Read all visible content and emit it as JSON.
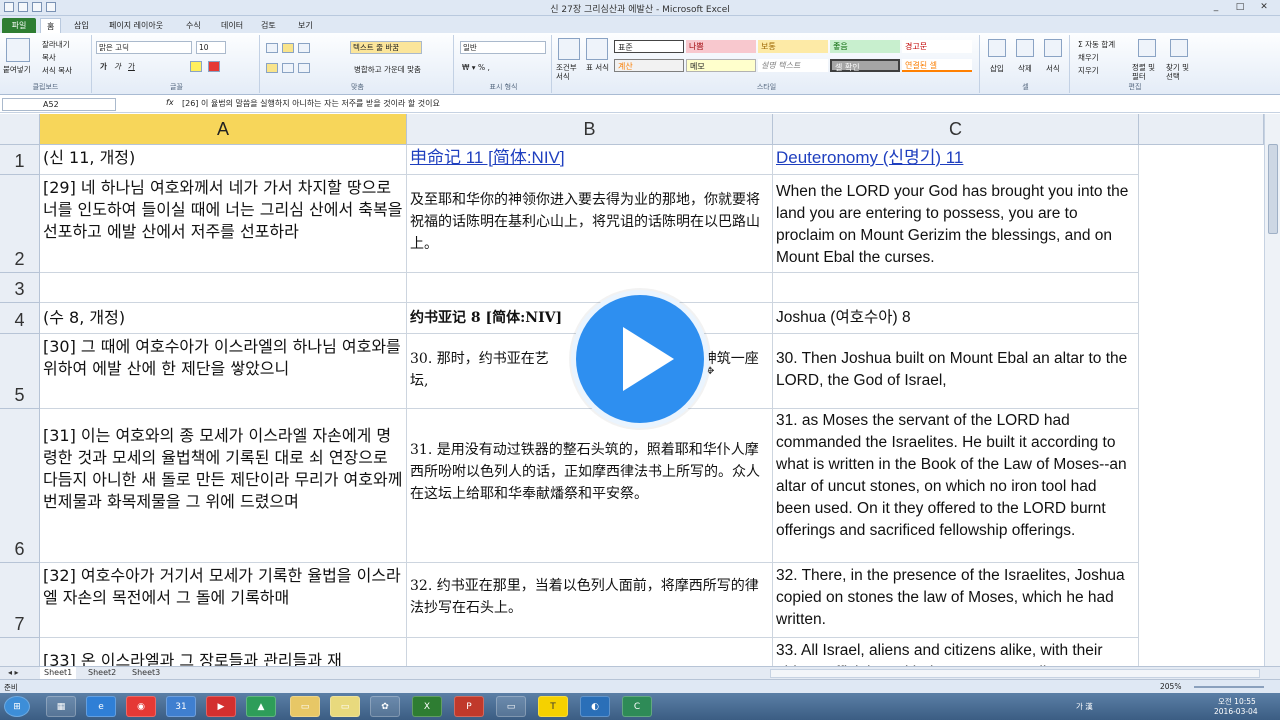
{
  "window": {
    "title": "신 27장 그리심산과 에발산 - Microsoft Excel",
    "controls": [
      "_",
      "□",
      "✕"
    ]
  },
  "ribbon_tabs": [
    "파일",
    "홈",
    "삽입",
    "페이지 레이아웃",
    "수식",
    "데이터",
    "검토",
    "보기"
  ],
  "ribbon": {
    "clipboard": {
      "paste": "붙여넣기",
      "cut": "잘라내기",
      "copy": "복사",
      "format_painter": "서식 복사",
      "label": "클립보드"
    },
    "font": {
      "name": "맑은 고딕",
      "size": "10",
      "label": "글꼴"
    },
    "alignment": {
      "wrap": "텍스트 줄 바꿈",
      "merge": "병합하고 가운데 맞춤",
      "label": "맞춤"
    },
    "number": {
      "format": "일반",
      "label": "표시 형식"
    },
    "styles": {
      "cond_format": "조건부 서식",
      "table_format": "표 서식",
      "cells": [
        "표준",
        "나쁨",
        "보통",
        "좋음",
        "경고문",
        "계산",
        "메모",
        "설명 텍스트",
        "셀 확인",
        "연결된 셀"
      ],
      "label": "스타일"
    },
    "cells_group": {
      "insert": "삽입",
      "delete": "삭제",
      "format": "서식",
      "label": "셀"
    },
    "editing": {
      "autosum": "자동 합계",
      "fill": "채우기",
      "clear": "지우기",
      "sort": "정렬 및 필터",
      "find": "찾기 및 선택",
      "label": "편집"
    }
  },
  "formula_bar": {
    "name_box": "A52",
    "fx": "fx",
    "formula": "[26] 이 율법의 말씀을 실행하지 아니하는 자는 저주를 받을 것이라 할 것이요"
  },
  "columns": [
    "A",
    "B",
    "C"
  ],
  "rows": [
    {
      "num": "1",
      "a": "(신 11, 개정)",
      "b": "申命记 11 [简体:NIV]",
      "c": "Deuteronomy (신명기) 11"
    },
    {
      "num": "2",
      "a": "[29] 네 하나님 여호와께서 네가 가서 차지할 땅으로 너를 인도하여 들이실 때에 너는 그리심 산에서 축복을 선포하고 에발 산에서 저주를 선포하라",
      "b": "及至耶和华你的神领你进入要去得为业的那地，你就要将祝福的话陈明在基利心山上，将咒诅的话陈明在以巴路山上。",
      "c": "When the LORD your God has brought you into the land you are entering to possess, you are to proclaim on Mount Gerizim the blessings, and on Mount Ebal the curses."
    },
    {
      "num": "3",
      "a": "",
      "b": "",
      "c": ""
    },
    {
      "num": "4",
      "a": "(수 8, 개정)",
      "b": "约书亚记 8 [简体:NIV]",
      "c": "Joshua (여호수아) 8"
    },
    {
      "num": "5",
      "a": "[30] 그 때에 여호수아가 이스라엘의 하나님 여호와를 위하여 에발 산에 한 제단을 쌓았으니",
      "b": "30. 那时，约书亚在艺　　　　　　　以色列的神筑一座坛,",
      "c": "30. Then Joshua built on Mount Ebal an altar to the LORD, the God of Israel,"
    },
    {
      "num": "6",
      "a": "[31] 이는 여호와의 종 모세가 이스라엘 자손에게 명령한 것과 모세의 율법책에 기록된 대로 쇠 연장으로 다듬지 아니한 새 돌로 만든 제단이라 무리가 여호와께 번제물과 화목제물을 그 위에 드렸으며",
      "b": "31. 是用没有动过铁器的整石头筑的，照着耶和华仆人摩西所吩咐以色列人的话，正如摩西律法书上所写的。众人在这坛上给耶和华奉献燔祭和平安祭。",
      "c": "31. as Moses the servant of the LORD had commanded the Israelites. He built it according to what is written in the Book of the Law of Moses--an altar of uncut stones, on which no iron tool had been used. On it they offered to the LORD burnt offerings and sacrificed fellowship offerings."
    },
    {
      "num": "7",
      "a": "[32] 여호수아가 거기서 모세가 기록한 율법을 이스라엘 자손의 목전에서 그 돌에 기록하매",
      "b": "32. 约书亚在那里，当着以色列人面前，将摩西所写的律法抄写在石头上。",
      "c": "32. There, in the presence of the Israelites, Joshua copied on stones the law of Moses, which he had written."
    },
    {
      "num": "",
      "a": "[33] 온 이스라엘과 그 장로들과 관리들과 재",
      "b": "",
      "c": "33. All Israel, aliens and citizens alike, with their elders, officials and judges, were standing on"
    }
  ],
  "sheet_tabs": [
    "Sheet1",
    "Sheet2",
    "Sheet3"
  ],
  "status": {
    "ready": "준비",
    "zoom": "205%"
  },
  "taskbar": {
    "clock_time": "오전 10:55",
    "clock_date": "2016-03-04",
    "tray": "가 漢"
  }
}
